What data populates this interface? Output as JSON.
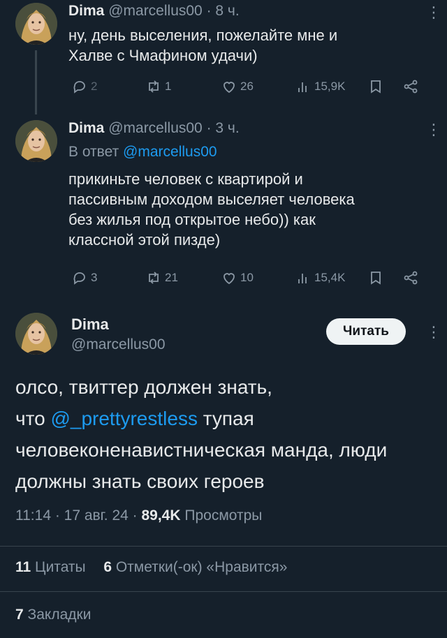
{
  "tweets": [
    {
      "author_name": "Dima",
      "author_handle": "@marcellus00",
      "time": "· 8 ч.",
      "text_lines": [
        "ну, день выселения, пожелайте мне и",
        "Халве с Чмафином удачи)"
      ],
      "replies": "2",
      "retweets": "1",
      "likes": "26",
      "views": "15,9K"
    },
    {
      "author_name": "Dima",
      "author_handle": "@marcellus00",
      "time": "· 3 ч.",
      "reply_prefix": "В ответ",
      "reply_target": "@marcellus00",
      "text_lines": [
        "прикиньте человек с квартирой и",
        "пассивным доходом выселяет человека",
        "без жилья под открытое небо)) как",
        "классной этой пизде)"
      ],
      "replies": "3",
      "retweets": "21",
      "likes": "10",
      "views": "15,4K"
    }
  ],
  "main": {
    "author_name": "Dima",
    "author_handle": "@marcellus00",
    "follow_label": "Читать",
    "line1": "олсо, твиттер должен знать,",
    "line2_before": "что",
    "mention": "@_prettyrestless",
    "line2_after": "тупая",
    "line3": "человеконенавистническая манда, люди",
    "line4": "должны знать своих героев",
    "time_date": "11:14 · 17 авг. 24 ·",
    "views_count": "89,4K",
    "views_label": "Просмотры",
    "quotes_count": "11",
    "quotes_label": "Цитаты",
    "likes_count": "6",
    "likes_label": "Отметки(-ок) «Нравится»",
    "bookmarks_count": "7",
    "bookmarks_label": "Закладки"
  },
  "icons": [
    "reply-icon",
    "retweet-icon",
    "like-icon",
    "views-icon",
    "bookmark-icon",
    "share-icon",
    "more-icon"
  ],
  "colors": {
    "background": "#15202b",
    "accent": "#1d9bf0",
    "muted": "#8b98a5",
    "text": "#e7e9ea"
  }
}
